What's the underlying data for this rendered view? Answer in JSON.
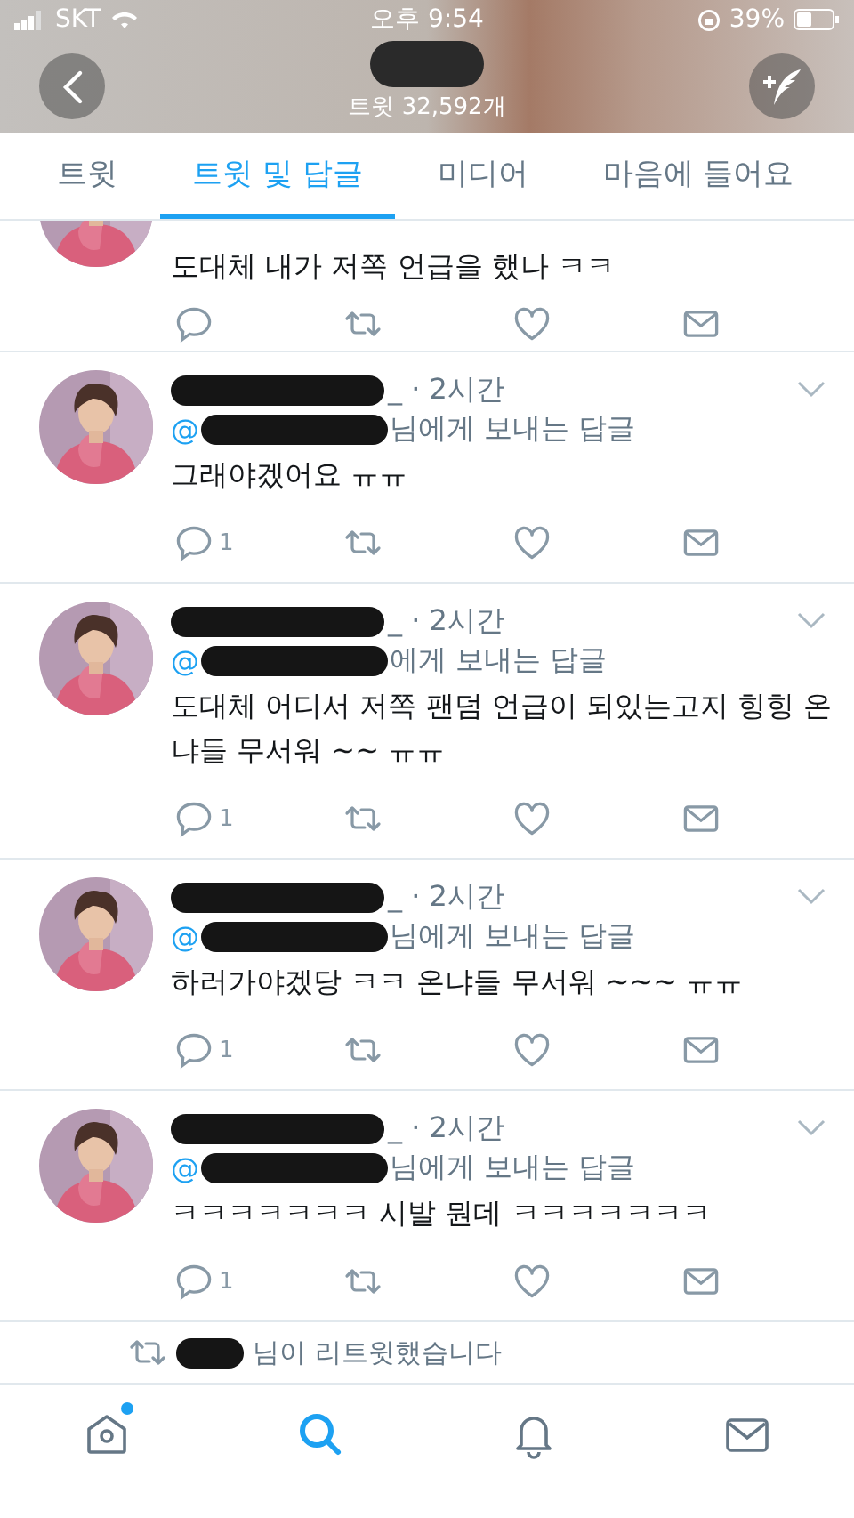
{
  "status_bar": {
    "carrier": "SKT",
    "time": "오후 9:54",
    "battery": "39%"
  },
  "header": {
    "tweet_count": "트윗 32,592개"
  },
  "tabs": [
    {
      "label": "트윗",
      "selected": false
    },
    {
      "label": "트윗 및 답글",
      "selected": true
    },
    {
      "label": "미디어",
      "selected": false
    },
    {
      "label": "마음에 들어요",
      "selected": false
    }
  ],
  "tweets": [
    {
      "kind": "clipped",
      "body": "도대체 내가 저쪽 언급을 했나 ㅋㅋ"
    },
    {
      "kind": "full",
      "meta": "_ · 2시간",
      "reply_prefix": "@",
      "reply_suffix": "님에게 보내는 답글",
      "body": "그래야겠어요 ㅠㅠ",
      "reply_count": "1"
    },
    {
      "kind": "full",
      "meta": "_ · 2시간",
      "reply_prefix": "@",
      "reply_suffix": "에게 보내는 답글",
      "body": "도대체 어디서 저쪽 팬덤 언급이 되있는고지 힝힝 온냐들 무서워 ~~ ㅠㅠ",
      "reply_count": "1"
    },
    {
      "kind": "full",
      "meta": "_ · 2시간",
      "reply_prefix": "@",
      "reply_suffix": "님에게 보내는 답글",
      "body": "하러가야겠당 ㅋㅋ 온냐들 무서워 ~~~ ㅠㅠ",
      "reply_count": "1"
    },
    {
      "kind": "full",
      "meta": "_ · 2시간",
      "reply_prefix": "@",
      "reply_suffix": "님에게 보내는 답글",
      "body": "ㅋㅋㅋㅋㅋㅋㅋ 시발 뭔데 ㅋㅋㅋㅋㅋㅋㅋ",
      "reply_count": "1"
    }
  ],
  "retweet_notice": "님이 리트윗했습니다",
  "bottom_nav": [
    {
      "kind": "home",
      "selected": false,
      "badge": true
    },
    {
      "kind": "search",
      "selected": true,
      "badge": false
    },
    {
      "kind": "bell",
      "selected": false,
      "badge": false
    },
    {
      "kind": "mail",
      "selected": false,
      "badge": false
    }
  ]
}
